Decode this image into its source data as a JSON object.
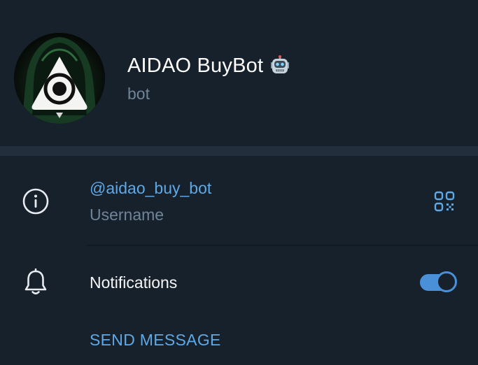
{
  "profile": {
    "name": "AIDAO BuyBot",
    "name_emoji": "robot-face",
    "subtitle": "bot",
    "avatar_icon": "hooded-eye-triangle-logo"
  },
  "info": {
    "icon": "info-circle-icon",
    "username": "@aidao_buy_bot",
    "username_caption": "Username",
    "qr_icon": "qr-code-icon"
  },
  "notifications": {
    "icon": "bell-icon",
    "label": "Notifications",
    "enabled": true
  },
  "actions": {
    "send_message_label": "SEND MESSAGE"
  },
  "colors": {
    "background": "#17212b",
    "band": "#232e3c",
    "accent": "#5fa8e6",
    "muted": "#708499",
    "toggle_on": "#4a90d9"
  }
}
